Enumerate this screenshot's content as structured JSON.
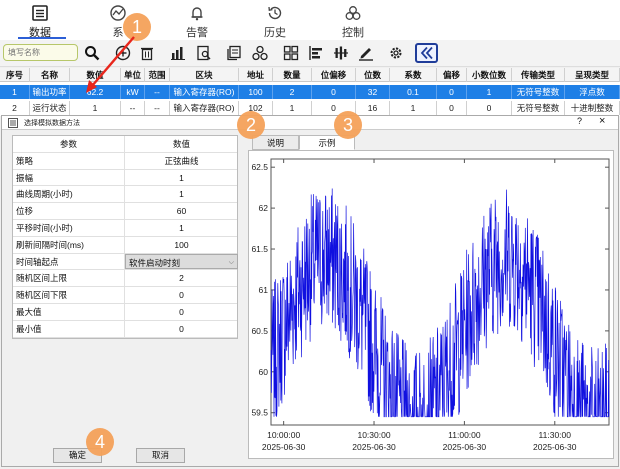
{
  "nav": {
    "items": [
      {
        "label": "数据",
        "icon": "list-icon"
      },
      {
        "label": "系",
        "icon": "chart-icon"
      },
      {
        "label": "告警",
        "icon": "bell-icon"
      },
      {
        "label": "历史",
        "icon": "history-icon"
      },
      {
        "label": "控制",
        "icon": "control-icon"
      }
    ]
  },
  "toolbar": {
    "search_placeholder": "填写名称"
  },
  "table": {
    "headers": [
      "序号",
      "名称",
      "数值",
      "单位",
      "范围",
      "区块",
      "地址",
      "数量",
      "位偏移",
      "位数",
      "系数",
      "偏移",
      "小数位数",
      "传输类型",
      "呈现类型"
    ],
    "rows": [
      [
        "1",
        "输出功率",
        "62.2",
        "kW",
        "--",
        "输入寄存器(RO)",
        "100",
        "2",
        "0",
        "32",
        "0.1",
        "0",
        "1",
        "无符号整数",
        "浮点数"
      ],
      [
        "2",
        "运行状态",
        "1",
        "--",
        "--",
        "输入寄存器(RO)",
        "102",
        "1",
        "0",
        "16",
        "1",
        "0",
        "0",
        "无符号整数",
        "十进制整数"
      ]
    ]
  },
  "dialog": {
    "title": "选择模拟数据方法",
    "help": "?",
    "close": "×",
    "param_header": {
      "name": "参数",
      "value": "数值"
    },
    "params": [
      {
        "name": "策略",
        "value": "正弦曲线"
      },
      {
        "name": "振幅",
        "value": "1"
      },
      {
        "name": "曲线周期(小时)",
        "value": "1"
      },
      {
        "name": "位移",
        "value": "60"
      },
      {
        "name": "平移时间(小时)",
        "value": "1"
      },
      {
        "name": "刷新间隔时间(ms)",
        "value": "100"
      },
      {
        "name": "时间轴起点",
        "value": "软件启动时刻",
        "dropdown": true
      },
      {
        "name": "随机区间上限",
        "value": "2"
      },
      {
        "name": "随机区间下限",
        "value": "0"
      },
      {
        "name": "最大值",
        "value": "0"
      },
      {
        "name": "最小值",
        "value": "0"
      }
    ],
    "tabs": [
      "说明",
      "示例"
    ],
    "ok_label": "确定",
    "cancel_label": "取消"
  },
  "annotations": [
    "1",
    "2",
    "3",
    "4"
  ],
  "colors": {
    "accent": "#1e7fe6",
    "series": "#1010e0",
    "annotation": "#f5a25a",
    "nav_underline": "#2c5fd6"
  },
  "chart_data": {
    "type": "line",
    "title": "",
    "xlabel": "",
    "ylabel": "",
    "ylim": [
      59.35,
      62.6
    ],
    "yticks": [
      59.5,
      60,
      60.5,
      61,
      61.5,
      62,
      62.5
    ],
    "xticks": [
      {
        "time": "10:00:00",
        "date": "2025-06-30",
        "hour": 0
      },
      {
        "time": "10:30:00",
        "date": "2025-06-30",
        "hour": 0.5
      },
      {
        "time": "11:00:00",
        "date": "2025-06-30",
        "hour": 1
      },
      {
        "time": "11:30:00",
        "date": "2025-06-30",
        "hour": 1.5
      }
    ],
    "xlim_hours": [
      -0.07,
      1.8
    ],
    "series": [
      {
        "amplitude": 1,
        "period_hours": 1,
        "offset": 60,
        "noise_lower": 0,
        "noise_upper": 2,
        "peaks": [
          62.4,
          62.1,
          62.5
        ]
      }
    ]
  }
}
